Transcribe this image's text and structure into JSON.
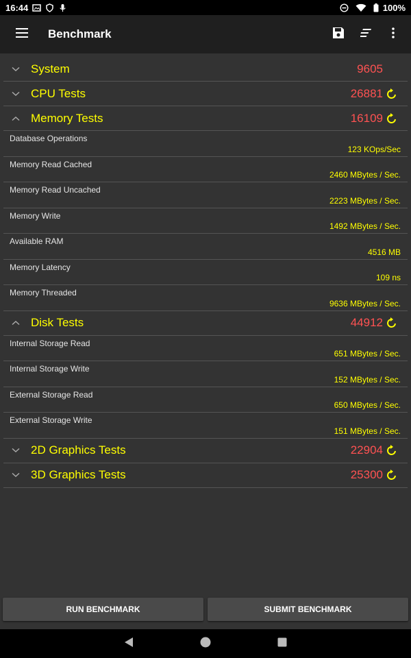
{
  "status_bar": {
    "time": "16:44",
    "battery": "100%"
  },
  "app_bar": {
    "title": "Benchmark"
  },
  "groups": [
    {
      "name": "System",
      "score": "9605",
      "expanded": false,
      "has_refresh": false,
      "items": []
    },
    {
      "name": "CPU Tests",
      "score": "26881",
      "expanded": false,
      "has_refresh": true,
      "items": []
    },
    {
      "name": "Memory Tests",
      "score": "16109",
      "expanded": true,
      "has_refresh": true,
      "items": [
        {
          "label": "Database Operations",
          "value": "123 KOps/Sec"
        },
        {
          "label": "Memory Read Cached",
          "value": "2460 MBytes / Sec."
        },
        {
          "label": "Memory Read Uncached",
          "value": "2223 MBytes / Sec."
        },
        {
          "label": "Memory Write",
          "value": "1492 MBytes / Sec."
        },
        {
          "label": "Available RAM",
          "value": "4516 MB"
        },
        {
          "label": "Memory Latency",
          "value": "109 ns"
        },
        {
          "label": "Memory Threaded",
          "value": "9636 MBytes / Sec."
        }
      ]
    },
    {
      "name": "Disk Tests",
      "score": "44912",
      "expanded": true,
      "has_refresh": true,
      "items": [
        {
          "label": "Internal Storage Read",
          "value": "651 MBytes / Sec."
        },
        {
          "label": "Internal Storage Write",
          "value": "152 MBytes / Sec."
        },
        {
          "label": "External Storage Read",
          "value": "650 MBytes / Sec."
        },
        {
          "label": "External Storage Write",
          "value": "151 MBytes / Sec."
        }
      ]
    },
    {
      "name": "2D Graphics Tests",
      "score": "22904",
      "expanded": false,
      "has_refresh": true,
      "items": []
    },
    {
      "name": "3D Graphics Tests",
      "score": "25300",
      "expanded": false,
      "has_refresh": true,
      "items": []
    }
  ],
  "buttons": {
    "run": "RUN BENCHMARK",
    "submit": "SUBMIT BENCHMARK"
  },
  "colors": {
    "accent": "#ffff00",
    "score": "#ff5252",
    "background": "#333333",
    "appbar": "#1f1f1f"
  },
  "icons": [
    "menu-icon",
    "save-icon",
    "sort-icon",
    "more-vert-icon",
    "chevron-down-icon",
    "chevron-up-icon",
    "refresh-icon",
    "back-icon",
    "home-icon",
    "recents-icon"
  ]
}
